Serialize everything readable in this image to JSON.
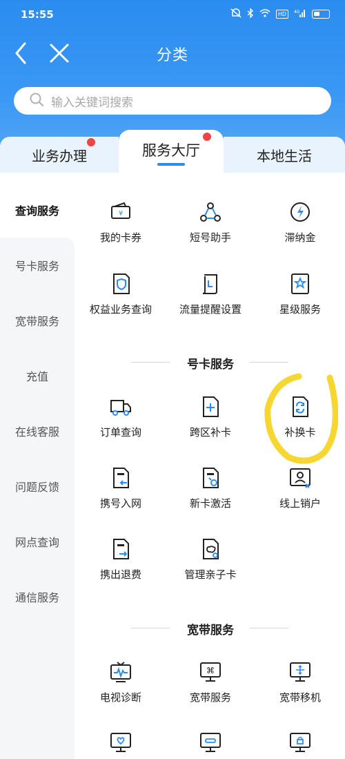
{
  "status_bar": {
    "time": "15:55",
    "hd": "HD",
    "signal": "4G"
  },
  "nav": {
    "title": "分类"
  },
  "search": {
    "placeholder": "输入关键词搜索"
  },
  "tabs": [
    {
      "label": "业务办理",
      "badge": true
    },
    {
      "label": "服务大厅",
      "badge": true,
      "active": true
    },
    {
      "label": "本地生活",
      "badge": false
    }
  ],
  "sidebar": {
    "items": [
      {
        "label": "查询服务",
        "active": true
      },
      {
        "label": "号卡服务"
      },
      {
        "label": "宽带服务"
      },
      {
        "label": "充值"
      },
      {
        "label": "在线客服"
      },
      {
        "label": "问题反馈"
      },
      {
        "label": "网点查询"
      },
      {
        "label": "通信服务"
      }
    ]
  },
  "sections": {
    "query": {
      "items": [
        {
          "label": "我的卡券",
          "icon": "coupon-icon"
        },
        {
          "label": "短号助手",
          "icon": "network-icon"
        },
        {
          "label": "滞纳金",
          "icon": "lightning-icon"
        },
        {
          "label": "权益业务查询",
          "icon": "shield-document-icon"
        },
        {
          "label": "流量提醒设置",
          "icon": "data-scroll-icon"
        },
        {
          "label": "星级服务",
          "icon": "star-document-icon"
        }
      ]
    },
    "card": {
      "title": "号卡服务",
      "items": [
        {
          "label": "订单查询",
          "icon": "truck-icon"
        },
        {
          "label": "跨区补卡",
          "icon": "sim-plus-icon"
        },
        {
          "label": "补换卡",
          "icon": "sim-refresh-icon"
        },
        {
          "label": "携号入网",
          "icon": "sim-in-icon"
        },
        {
          "label": "新卡激活",
          "icon": "sim-activate-icon"
        },
        {
          "label": "线上销户",
          "icon": "user-cancel-icon"
        },
        {
          "label": "携出退费",
          "icon": "sim-out-icon"
        },
        {
          "label": "管理亲子卡",
          "icon": "family-card-icon"
        }
      ]
    },
    "broadband": {
      "title": "宽带服务",
      "items": [
        {
          "label": "电视诊断",
          "icon": "tv-pulse-icon"
        },
        {
          "label": "宽带服务",
          "icon": "monitor-command-icon"
        },
        {
          "label": "宽带移机",
          "icon": "monitor-move-icon"
        }
      ]
    }
  },
  "colors": {
    "primary": "#2b8cf0",
    "badge": "#ee4444",
    "highlight": "#f5d31f"
  }
}
